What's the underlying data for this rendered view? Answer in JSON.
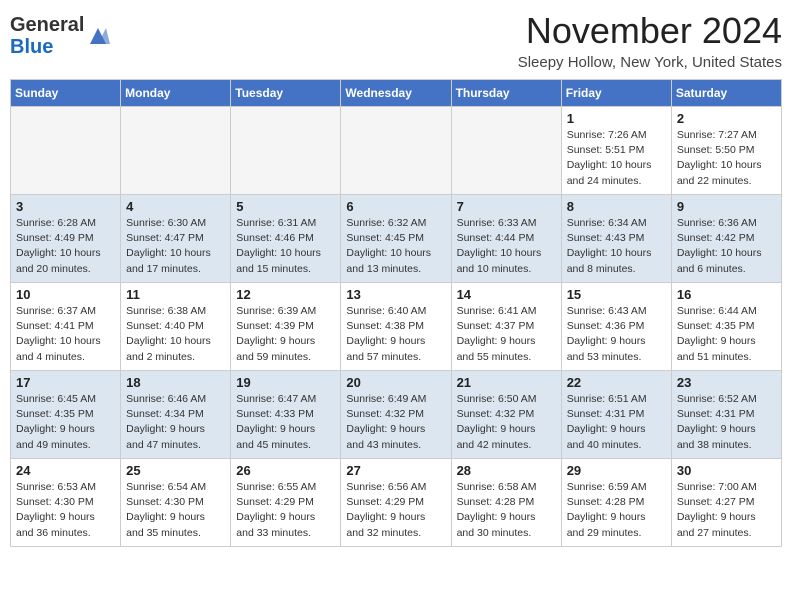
{
  "header": {
    "logo_line1": "General",
    "logo_line2": "Blue",
    "month": "November 2024",
    "location": "Sleepy Hollow, New York, United States"
  },
  "weekdays": [
    "Sunday",
    "Monday",
    "Tuesday",
    "Wednesday",
    "Thursday",
    "Friday",
    "Saturday"
  ],
  "weeks": [
    [
      {
        "day": "",
        "info": ""
      },
      {
        "day": "",
        "info": ""
      },
      {
        "day": "",
        "info": ""
      },
      {
        "day": "",
        "info": ""
      },
      {
        "day": "",
        "info": ""
      },
      {
        "day": "1",
        "info": "Sunrise: 7:26 AM\nSunset: 5:51 PM\nDaylight: 10 hours and 24 minutes."
      },
      {
        "day": "2",
        "info": "Sunrise: 7:27 AM\nSunset: 5:50 PM\nDaylight: 10 hours and 22 minutes."
      }
    ],
    [
      {
        "day": "3",
        "info": "Sunrise: 6:28 AM\nSunset: 4:49 PM\nDaylight: 10 hours and 20 minutes."
      },
      {
        "day": "4",
        "info": "Sunrise: 6:30 AM\nSunset: 4:47 PM\nDaylight: 10 hours and 17 minutes."
      },
      {
        "day": "5",
        "info": "Sunrise: 6:31 AM\nSunset: 4:46 PM\nDaylight: 10 hours and 15 minutes."
      },
      {
        "day": "6",
        "info": "Sunrise: 6:32 AM\nSunset: 4:45 PM\nDaylight: 10 hours and 13 minutes."
      },
      {
        "day": "7",
        "info": "Sunrise: 6:33 AM\nSunset: 4:44 PM\nDaylight: 10 hours and 10 minutes."
      },
      {
        "day": "8",
        "info": "Sunrise: 6:34 AM\nSunset: 4:43 PM\nDaylight: 10 hours and 8 minutes."
      },
      {
        "day": "9",
        "info": "Sunrise: 6:36 AM\nSunset: 4:42 PM\nDaylight: 10 hours and 6 minutes."
      }
    ],
    [
      {
        "day": "10",
        "info": "Sunrise: 6:37 AM\nSunset: 4:41 PM\nDaylight: 10 hours and 4 minutes."
      },
      {
        "day": "11",
        "info": "Sunrise: 6:38 AM\nSunset: 4:40 PM\nDaylight: 10 hours and 2 minutes."
      },
      {
        "day": "12",
        "info": "Sunrise: 6:39 AM\nSunset: 4:39 PM\nDaylight: 9 hours and 59 minutes."
      },
      {
        "day": "13",
        "info": "Sunrise: 6:40 AM\nSunset: 4:38 PM\nDaylight: 9 hours and 57 minutes."
      },
      {
        "day": "14",
        "info": "Sunrise: 6:41 AM\nSunset: 4:37 PM\nDaylight: 9 hours and 55 minutes."
      },
      {
        "day": "15",
        "info": "Sunrise: 6:43 AM\nSunset: 4:36 PM\nDaylight: 9 hours and 53 minutes."
      },
      {
        "day": "16",
        "info": "Sunrise: 6:44 AM\nSunset: 4:35 PM\nDaylight: 9 hours and 51 minutes."
      }
    ],
    [
      {
        "day": "17",
        "info": "Sunrise: 6:45 AM\nSunset: 4:35 PM\nDaylight: 9 hours and 49 minutes."
      },
      {
        "day": "18",
        "info": "Sunrise: 6:46 AM\nSunset: 4:34 PM\nDaylight: 9 hours and 47 minutes."
      },
      {
        "day": "19",
        "info": "Sunrise: 6:47 AM\nSunset: 4:33 PM\nDaylight: 9 hours and 45 minutes."
      },
      {
        "day": "20",
        "info": "Sunrise: 6:49 AM\nSunset: 4:32 PM\nDaylight: 9 hours and 43 minutes."
      },
      {
        "day": "21",
        "info": "Sunrise: 6:50 AM\nSunset: 4:32 PM\nDaylight: 9 hours and 42 minutes."
      },
      {
        "day": "22",
        "info": "Sunrise: 6:51 AM\nSunset: 4:31 PM\nDaylight: 9 hours and 40 minutes."
      },
      {
        "day": "23",
        "info": "Sunrise: 6:52 AM\nSunset: 4:31 PM\nDaylight: 9 hours and 38 minutes."
      }
    ],
    [
      {
        "day": "24",
        "info": "Sunrise: 6:53 AM\nSunset: 4:30 PM\nDaylight: 9 hours and 36 minutes."
      },
      {
        "day": "25",
        "info": "Sunrise: 6:54 AM\nSunset: 4:30 PM\nDaylight: 9 hours and 35 minutes."
      },
      {
        "day": "26",
        "info": "Sunrise: 6:55 AM\nSunset: 4:29 PM\nDaylight: 9 hours and 33 minutes."
      },
      {
        "day": "27",
        "info": "Sunrise: 6:56 AM\nSunset: 4:29 PM\nDaylight: 9 hours and 32 minutes."
      },
      {
        "day": "28",
        "info": "Sunrise: 6:58 AM\nSunset: 4:28 PM\nDaylight: 9 hours and 30 minutes."
      },
      {
        "day": "29",
        "info": "Sunrise: 6:59 AM\nSunset: 4:28 PM\nDaylight: 9 hours and 29 minutes."
      },
      {
        "day": "30",
        "info": "Sunrise: 7:00 AM\nSunset: 4:27 PM\nDaylight: 9 hours and 27 minutes."
      }
    ]
  ]
}
